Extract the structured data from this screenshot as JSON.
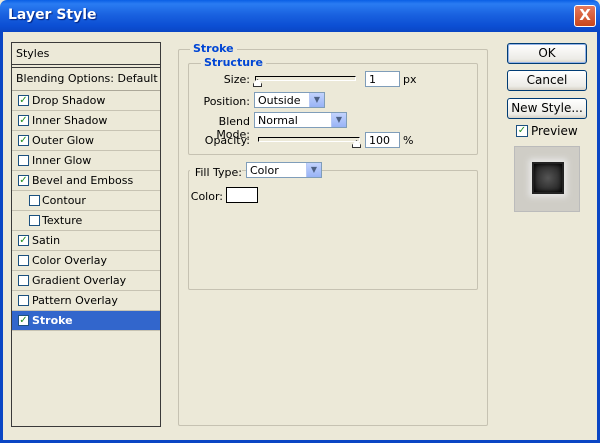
{
  "window": {
    "title": "Layer Style",
    "close_label": "X"
  },
  "styles_panel": {
    "header": "Styles",
    "blending": "Blending Options: Default",
    "items": [
      {
        "label": "Drop Shadow",
        "checked": true,
        "sub": false
      },
      {
        "label": "Inner Shadow",
        "checked": true,
        "sub": false
      },
      {
        "label": "Outer Glow",
        "checked": true,
        "sub": false
      },
      {
        "label": "Inner Glow",
        "checked": false,
        "sub": false
      },
      {
        "label": "Bevel and Emboss",
        "checked": true,
        "sub": false
      },
      {
        "label": "Contour",
        "checked": false,
        "sub": true
      },
      {
        "label": "Texture",
        "checked": false,
        "sub": true
      },
      {
        "label": "Satin",
        "checked": true,
        "sub": false
      },
      {
        "label": "Color Overlay",
        "checked": false,
        "sub": false
      },
      {
        "label": "Gradient Overlay",
        "checked": false,
        "sub": false
      },
      {
        "label": "Pattern Overlay",
        "checked": false,
        "sub": false
      },
      {
        "label": "Stroke",
        "checked": true,
        "sub": false,
        "selected": true
      }
    ]
  },
  "stroke": {
    "title": "Stroke",
    "structure": {
      "title": "Structure",
      "size_label": "Size:",
      "size_value": "1",
      "size_unit": "px",
      "position_label": "Position:",
      "position_value": "Outside",
      "blend_label": "Blend Mode:",
      "blend_value": "Normal",
      "opacity_label": "Opacity:",
      "opacity_value": "100",
      "opacity_unit": "%"
    },
    "fill": {
      "type_label": "Fill Type:",
      "type_value": "Color",
      "color_label": "Color:",
      "color_value": "#FFFFFF"
    }
  },
  "buttons": {
    "ok": "OK",
    "cancel": "Cancel",
    "new_style": "New Style..."
  },
  "preview": {
    "label": "Preview",
    "checked": true
  },
  "colors": {
    "titlebar": "#0A5FE5",
    "selection": "#3266CC",
    "group_label": "#0046D5"
  }
}
